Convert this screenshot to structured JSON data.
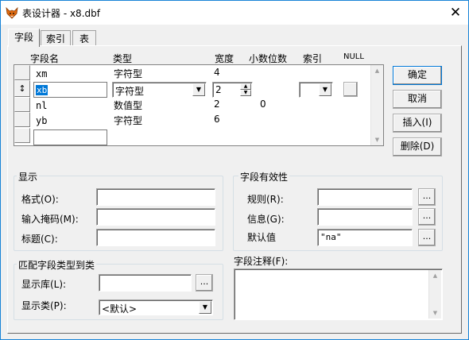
{
  "window": {
    "title": "表设计器 - x8.dbf",
    "close_glyph": "✕"
  },
  "tabs": [
    {
      "label": "字段"
    },
    {
      "label": "索引"
    },
    {
      "label": "表"
    }
  ],
  "grid": {
    "headers": {
      "name": "字段名",
      "type": "类型",
      "width": "宽度",
      "decimals": "小数位数",
      "index": "索引",
      "null": "NULL"
    },
    "row_marker": "↕",
    "rows": [
      {
        "name": "xm",
        "type": "字符型",
        "width": "4",
        "decimals": ""
      },
      {
        "name": "xb",
        "type": "字符型",
        "width": "2",
        "decimals": ""
      },
      {
        "name": "nl",
        "type": "数值型",
        "width": "2",
        "decimals": "0"
      },
      {
        "name": "yb",
        "type": "字符型",
        "width": "6",
        "decimals": ""
      }
    ],
    "new_row_name": ""
  },
  "buttons": {
    "ok": "确定",
    "cancel": "取消",
    "insert": "插入(I)",
    "delete": "删除(D)"
  },
  "display": {
    "title": "显示",
    "format_label": "格式(O):",
    "format_value": "",
    "mask_label": "输入掩码(M):",
    "mask_value": "",
    "caption_label": "标题(C):",
    "caption_value": ""
  },
  "validation": {
    "title": "字段有效性",
    "rule_label": "规则(R):",
    "rule_value": "",
    "message_label": "信息(G):",
    "message_value": "",
    "default_label": "默认值",
    "default_value": "\"na\"",
    "ellipsis": "..."
  },
  "mapping": {
    "title": "匹配字段类型到类",
    "library_label": "显示库(L):",
    "library_value": "",
    "class_label": "显示类(P):",
    "class_value": "<默认>"
  },
  "comment": {
    "label": "字段注释(F):",
    "value": ""
  },
  "colors": {
    "accent": "#1883d7",
    "selection": "#0078d7",
    "window_bg": "#f0f0f0"
  }
}
